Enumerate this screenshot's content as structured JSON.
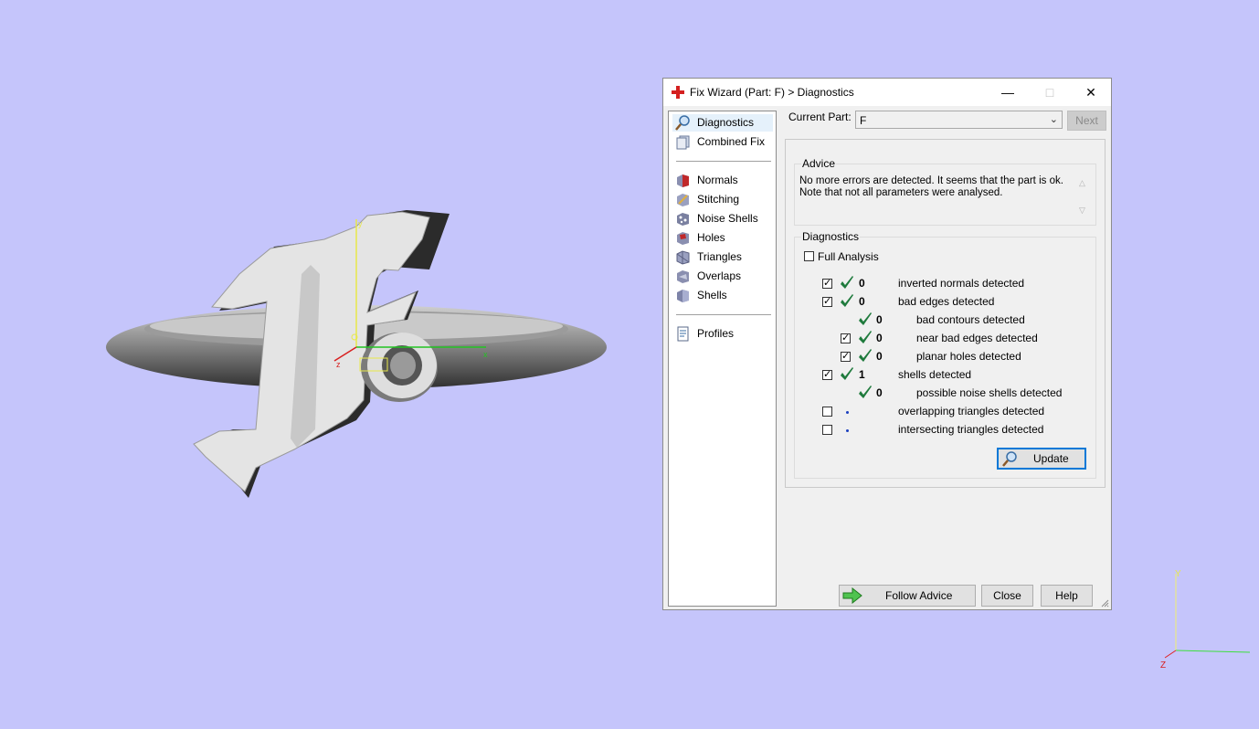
{
  "window": {
    "title": "Fix Wizard (Part: F) > Diagnostics",
    "minimize": "—",
    "maximize": "□",
    "close": "✕"
  },
  "nav": {
    "items": [
      {
        "label": "Diagnostics",
        "icon": "magnifier-icon",
        "selected": true
      },
      {
        "label": "Combined Fix",
        "icon": "combined-fix-icon"
      },
      {
        "label": "Normals",
        "icon": "normals-icon"
      },
      {
        "label": "Stitching",
        "icon": "stitching-icon"
      },
      {
        "label": "Noise Shells",
        "icon": "noise-shells-icon"
      },
      {
        "label": "Holes",
        "icon": "holes-icon"
      },
      {
        "label": "Triangles",
        "icon": "triangles-icon"
      },
      {
        "label": "Overlaps",
        "icon": "overlaps-icon"
      },
      {
        "label": "Shells",
        "icon": "shells-icon"
      },
      {
        "label": "Profiles",
        "icon": "profiles-icon"
      }
    ]
  },
  "current_part": {
    "label": "Current Part:",
    "value": "F",
    "next_label": "Next"
  },
  "advice": {
    "title": "Advice",
    "line1": "No more errors are detected. It seems that the part is ok.",
    "line2": "Note that not all parameters were analysed."
  },
  "diagnostics": {
    "title": "Diagnostics",
    "full_analysis": "Full Analysis",
    "rows": [
      {
        "label": "inverted normals detected",
        "count": "0",
        "checked": true
      },
      {
        "label": "bad edges detected",
        "count": "0",
        "checked": true
      },
      {
        "label": "bad contours detected",
        "count": "0"
      },
      {
        "label": "near bad edges detected",
        "count": "0",
        "checked": true
      },
      {
        "label": "planar holes detected",
        "count": "0",
        "checked": true
      },
      {
        "label": "shells detected",
        "count": "1",
        "checked": true
      },
      {
        "label": "possible noise shells detected",
        "count": "0"
      },
      {
        "label": "overlapping triangles detected",
        "checked": false
      },
      {
        "label": "intersecting triangles detected",
        "checked": false
      }
    ],
    "update_label": "Update"
  },
  "buttons": {
    "follow_advice": "Follow Advice",
    "close": "Close",
    "help": "Help"
  },
  "axes": {
    "x": "x",
    "y": "y",
    "z": "z",
    "corner_y": "Y",
    "corner_z": "Z"
  },
  "colors": {
    "background": "#c5c5fb",
    "ok_check": "#1e7a3c",
    "x_axis": "#22c422",
    "y_axis": "#e8e84a",
    "z_axis": "#d81f1f"
  }
}
